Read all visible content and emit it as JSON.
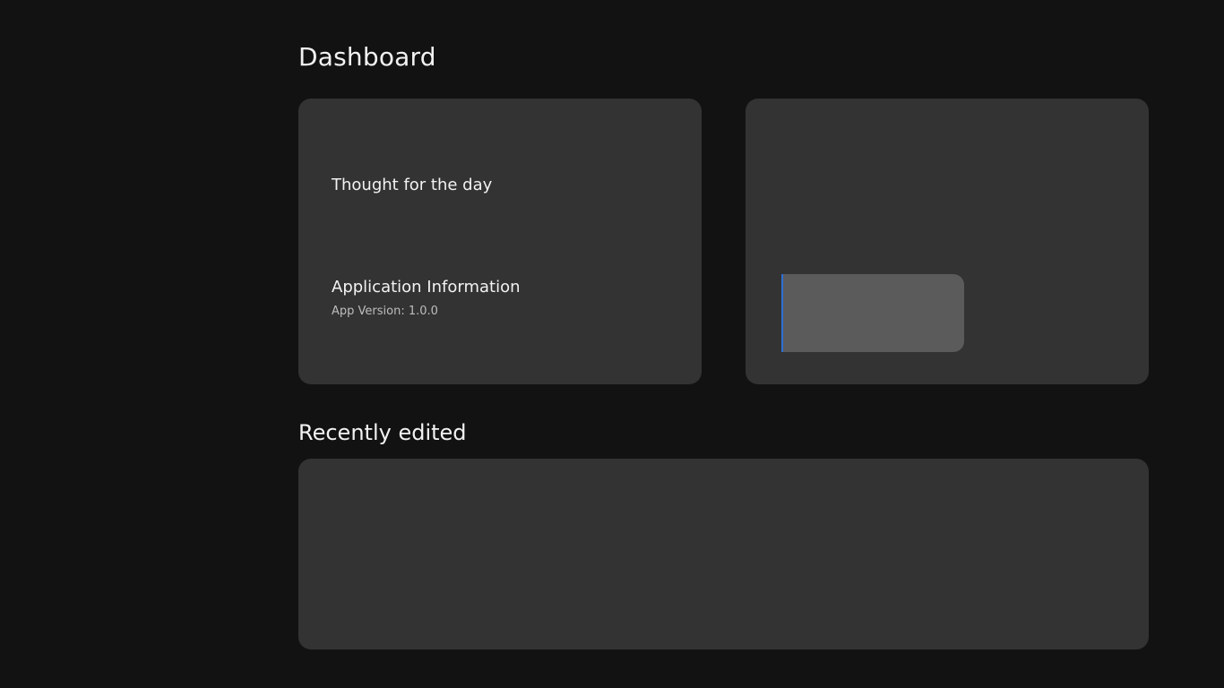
{
  "page": {
    "title": "Dashboard"
  },
  "cards": {
    "info": {
      "thought_title": "Thought for the day",
      "app_info_title": "Application Information",
      "app_version": "App Version: 1.0.0"
    },
    "widget": {
      "button_label": ""
    }
  },
  "recent": {
    "title": "Recently edited"
  },
  "colors": {
    "background": "#121212",
    "card": "#333333",
    "button": "#5b5b5b",
    "focus_accent": "#2f6fd6",
    "text_primary": "#f2f2f2",
    "text_secondary": "#bdbdbd"
  }
}
